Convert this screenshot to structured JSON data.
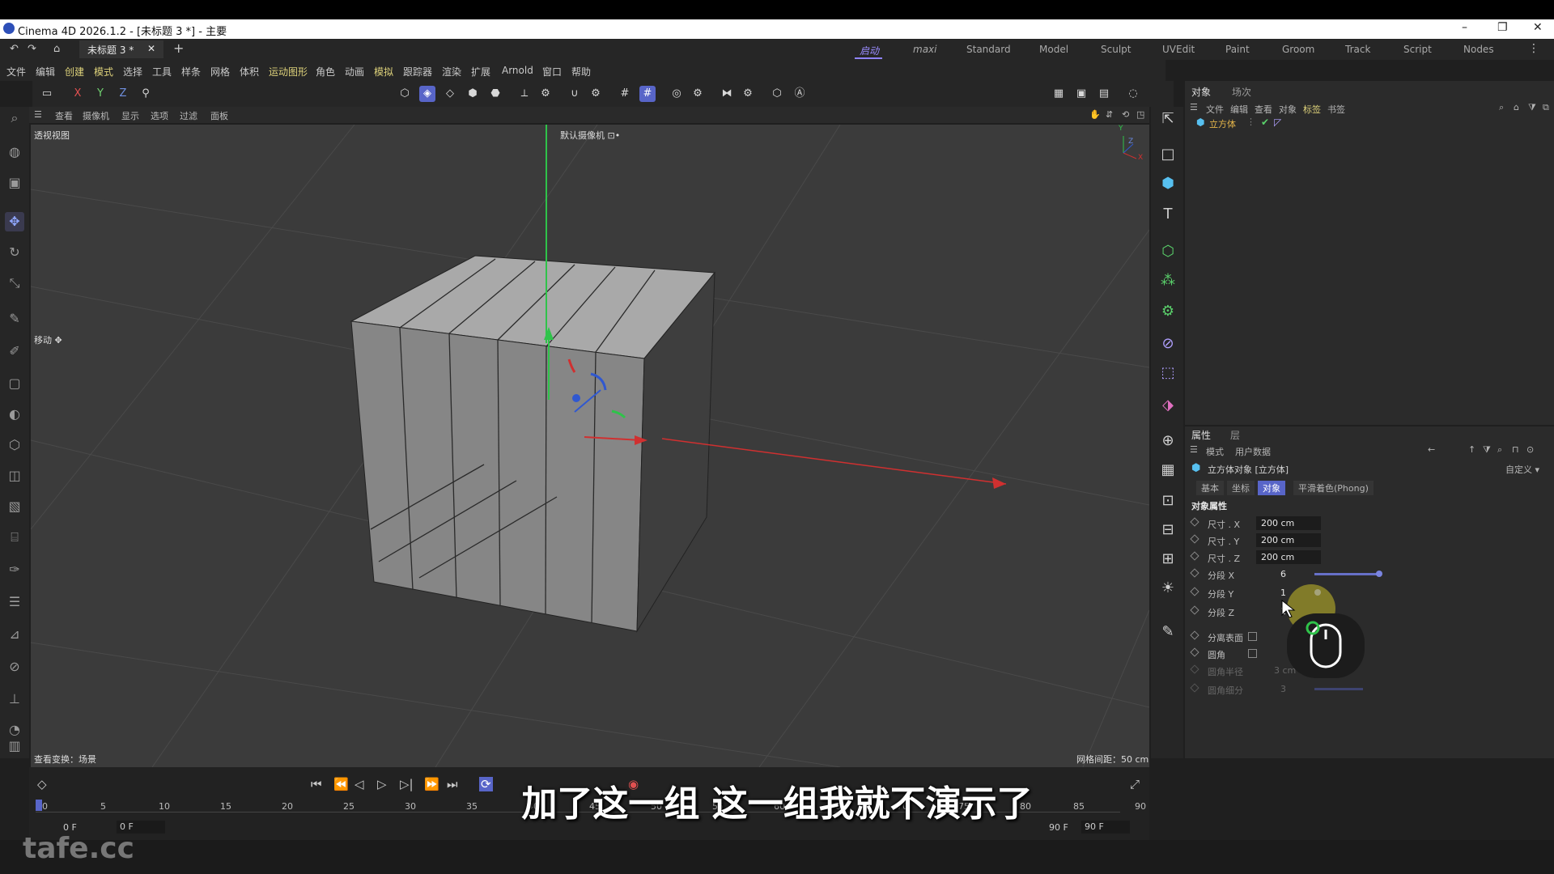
{
  "window": {
    "title": "Cinema 4D 2026.1.2 - [未标题 3 *] - 主要",
    "min": "–",
    "max": "❐",
    "close": "✕"
  },
  "tabs": {
    "doc_tab": "未标题 3 *",
    "close": "✕",
    "add": "+"
  },
  "layouts": [
    "启动",
    "maxi",
    "Standard",
    "Model",
    "Sculpt",
    "UVEdit",
    "Paint",
    "Groom",
    "Track",
    "Script",
    "Nodes"
  ],
  "menu": [
    "文件",
    "编辑",
    "创建",
    "模式",
    "选择",
    "工具",
    "样条",
    "网格",
    "体积",
    "运动图形",
    "角色",
    "动画",
    "模拟",
    "跟踪器",
    "渲染",
    "扩展",
    "Arnold",
    "窗口",
    "帮助"
  ],
  "axis_buttons": {
    "x": "X",
    "y": "Y",
    "z": "Z"
  },
  "viewport": {
    "menu": [
      "查看",
      "摄像机",
      "显示",
      "选项",
      "过滤",
      "面板"
    ],
    "name": "透视视图",
    "camera": "默认摄像机 ⊡•",
    "tool_label": "移动 ✥",
    "transform_label": "查看变换：场景",
    "grid_label": "网格间距：50 cm",
    "axis_y": "Y",
    "axis_z": "Z",
    "axis_x": "X"
  },
  "object_panel": {
    "tabs": [
      "对象",
      "场次"
    ],
    "menu": [
      "文件",
      "编辑",
      "查看",
      "对象",
      "标签",
      "书签"
    ],
    "object_name": "立方体"
  },
  "attr_panel": {
    "tabs": [
      "属性",
      "层"
    ],
    "menu": [
      "模式",
      "用户数据"
    ],
    "object_title": "立方体对象 [立方体]",
    "preset": "自定义 ▾",
    "subtabs": [
      "基本",
      "坐标",
      "对象",
      "平滑着色(Phong)"
    ],
    "section": "对象属性",
    "rows": [
      {
        "label": "尺寸 . X",
        "value": "200 cm"
      },
      {
        "label": "尺寸 . Y",
        "value": "200 cm"
      },
      {
        "label": "尺寸 . Z",
        "value": "200 cm"
      },
      {
        "label": "分段 X",
        "value": "6"
      },
      {
        "label": "分段 Y",
        "value": "1"
      },
      {
        "label": "分段 Z",
        "value": "1"
      }
    ],
    "checks": [
      {
        "label": "分离表面"
      },
      {
        "label": "圆角"
      }
    ],
    "dim_rows": [
      {
        "label": "圆角半径",
        "value": "3 cm"
      },
      {
        "label": "圆角细分",
        "value": "3"
      }
    ]
  },
  "timeline": {
    "ticks": [
      "0",
      "5",
      "10",
      "15",
      "20",
      "25",
      "30",
      "35",
      "40",
      "45",
      "50",
      "55",
      "60",
      "65",
      "70",
      "75",
      "80",
      "85",
      "90"
    ],
    "start": "0 F",
    "current": "0 F",
    "end1": "90 F",
    "end2": "90 F"
  },
  "subtitle": "加了这一组  这一组我就不演示了",
  "watermark": "tafe.cc",
  "colors": {
    "accent": "#5865c8",
    "highlight_menu": "#ddd17a",
    "cube": "#8c8c8c",
    "axis_x": "#d03030",
    "axis_y": "#2fc34a",
    "axis_z": "#3058d0"
  }
}
